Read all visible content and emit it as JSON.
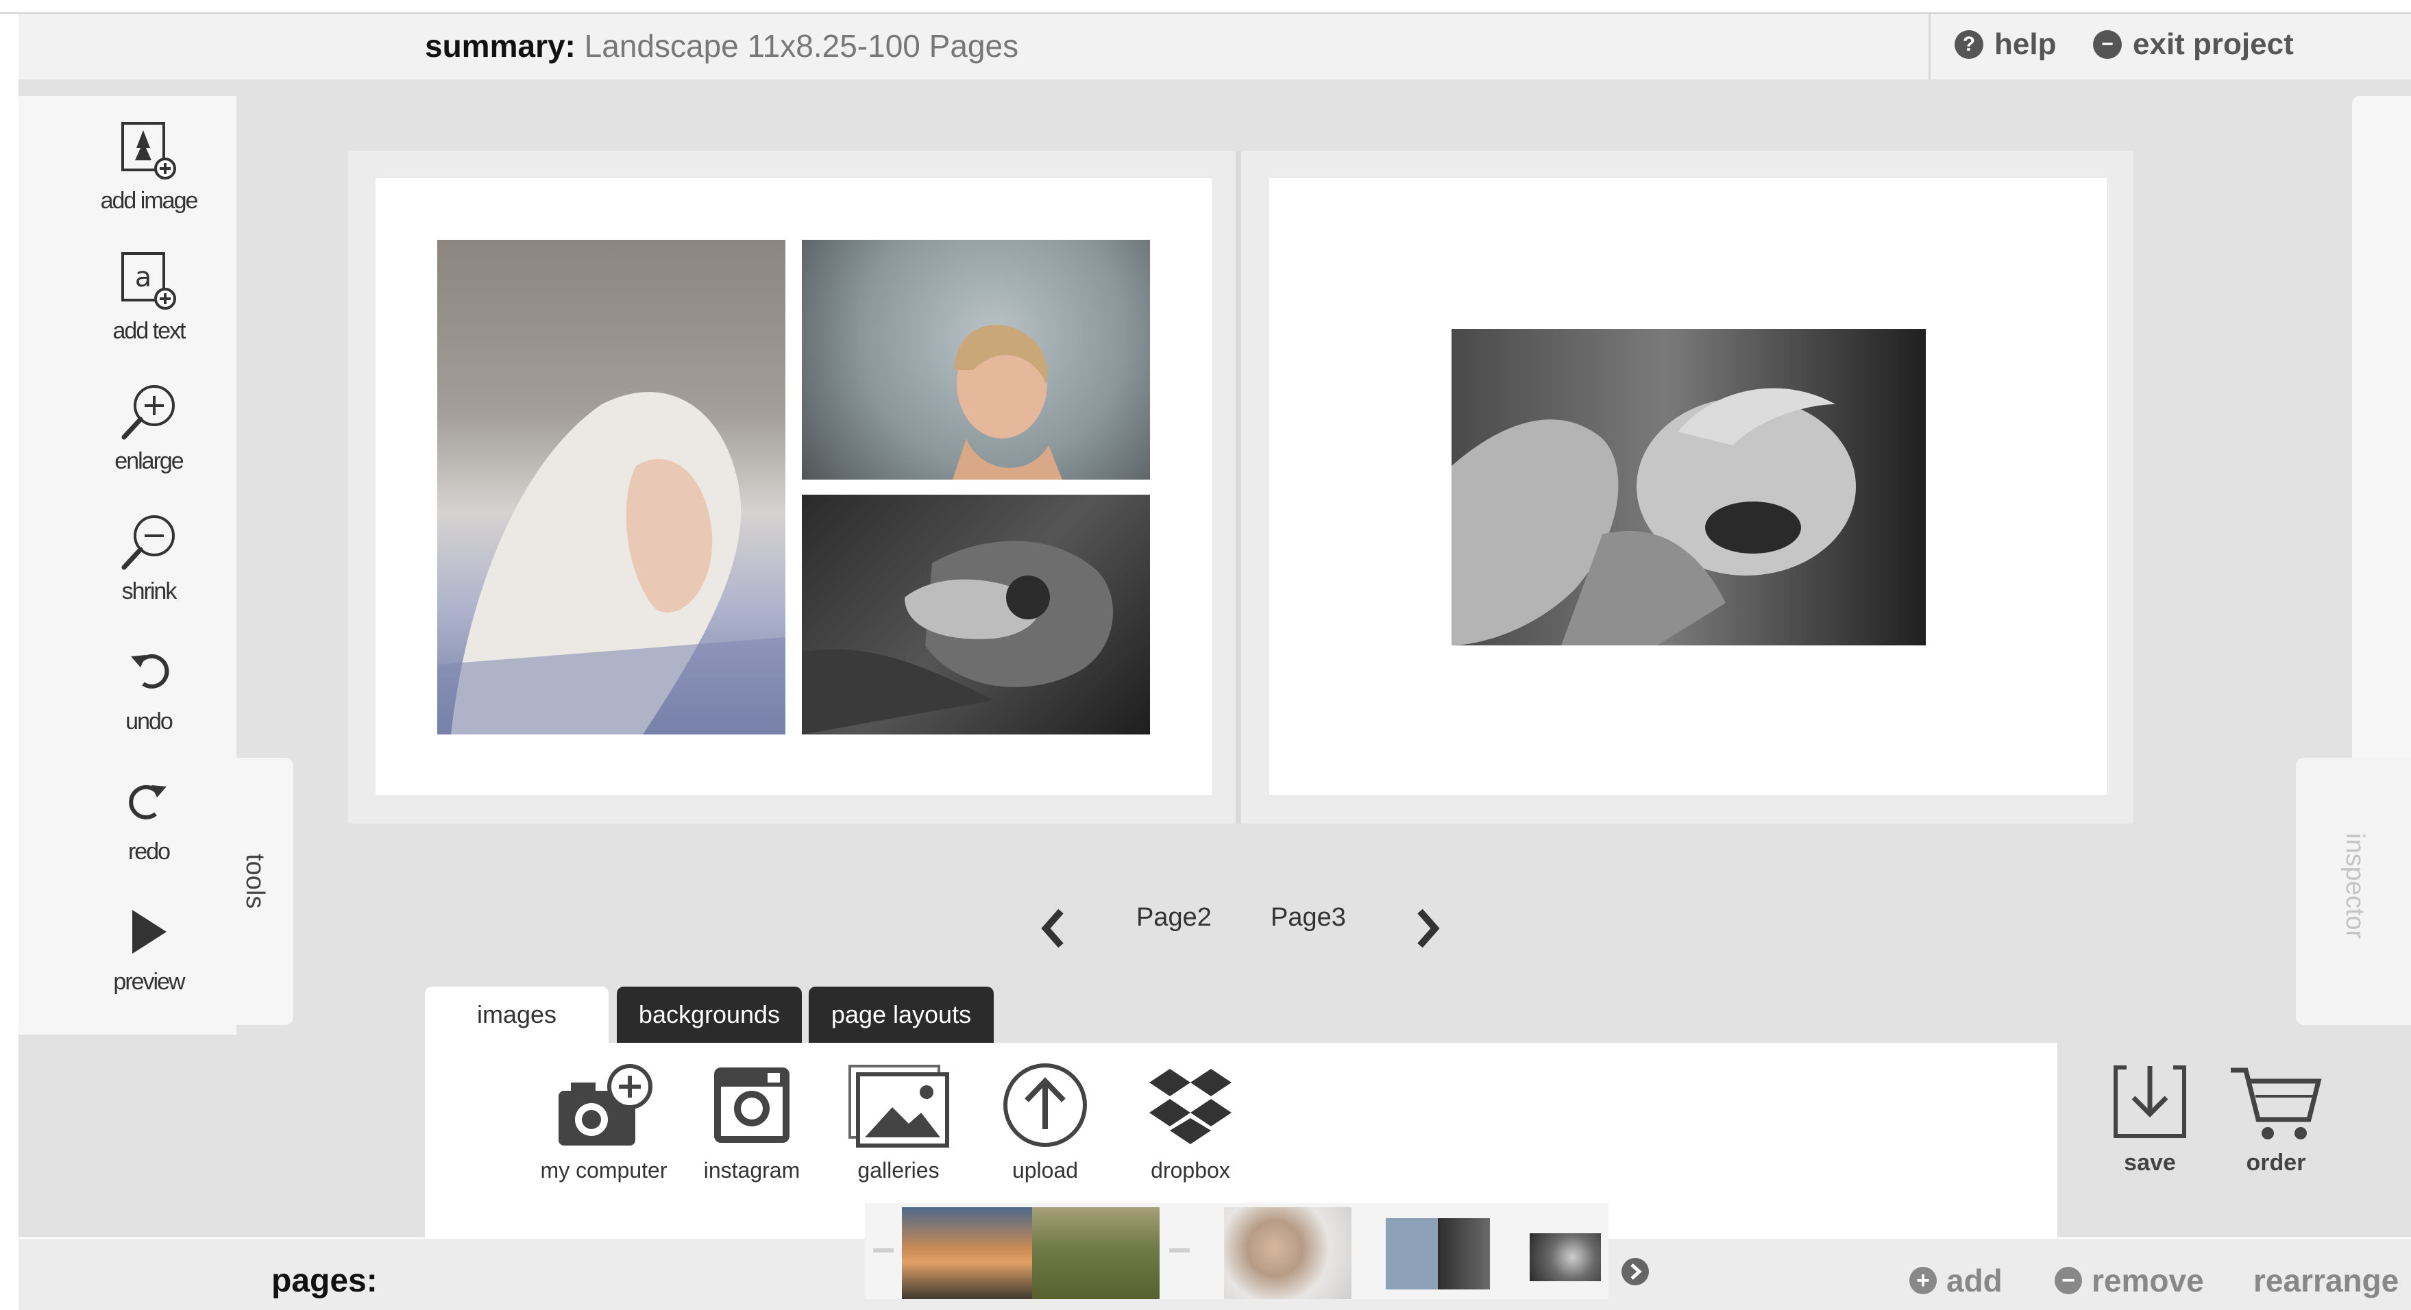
{
  "header": {
    "summary_label": "summary:",
    "summary_value": "Landscape 11x8.25-100 Pages",
    "help": "help",
    "exit_project": "exit project"
  },
  "tools": {
    "tab_label": "tools",
    "items": [
      {
        "label": "add image",
        "icon": "add-image-icon"
      },
      {
        "label": "add text",
        "icon": "add-text-icon"
      },
      {
        "label": "enlarge",
        "icon": "zoom-in-icon"
      },
      {
        "label": "shrink",
        "icon": "zoom-out-icon"
      },
      {
        "label": "undo",
        "icon": "undo-icon"
      },
      {
        "label": "redo",
        "icon": "redo-icon"
      },
      {
        "label": "preview",
        "icon": "play-icon"
      }
    ]
  },
  "inspector": {
    "tab_label": "inspector"
  },
  "pager": {
    "left_page": "Page2",
    "right_page": "Page3"
  },
  "tabs": [
    {
      "label": "images",
      "active": true
    },
    {
      "label": "backgrounds",
      "active": false
    },
    {
      "label": "page layouts",
      "active": false
    }
  ],
  "sources": [
    {
      "label": "my computer",
      "icon": "camera-add-icon"
    },
    {
      "label": "instagram",
      "icon": "instagram-icon"
    },
    {
      "label": "galleries",
      "icon": "gallery-icon"
    },
    {
      "label": "upload",
      "icon": "upload-icon"
    },
    {
      "label": "dropbox",
      "icon": "dropbox-icon"
    }
  ],
  "actions": {
    "save": "save",
    "order": "order"
  },
  "footer": {
    "pages_label": "pages:",
    "add": "add",
    "remove": "remove",
    "rearrange": "rearrange"
  },
  "colors": {
    "workspace_bg": "#e2e2e2",
    "toolbar_bg": "#f6f6f6",
    "active_tab": "#ffffff",
    "inactive_tab": "#2b2b2b",
    "footer_bg": "#ececec",
    "icon_dark": "#444444"
  }
}
